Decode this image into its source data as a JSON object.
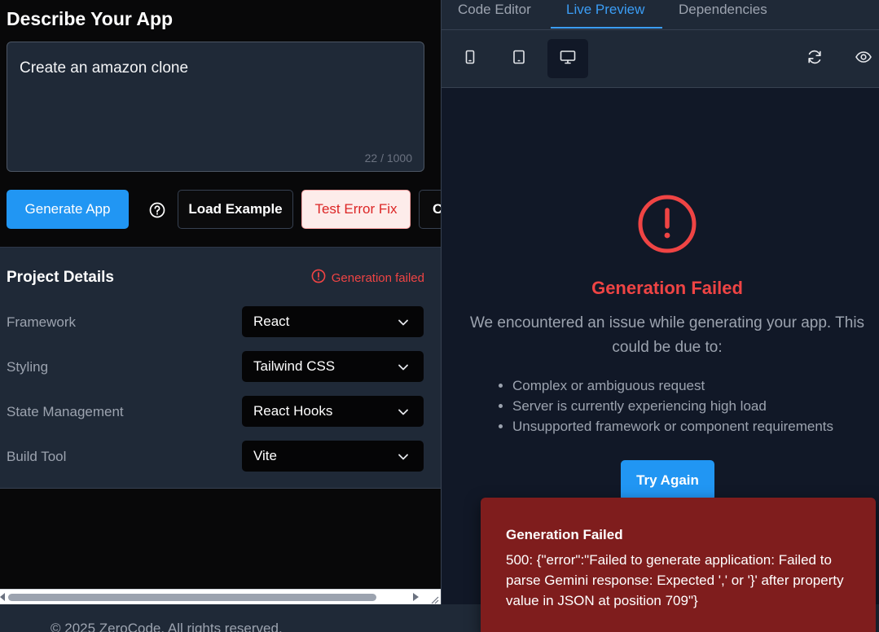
{
  "left": {
    "title": "Describe Your App",
    "prompt": {
      "value": "Create an amazon clone",
      "char_count": "22 / 1000"
    },
    "buttons": {
      "generate": "Generate App",
      "help_icon": "question-circle-icon",
      "load_example": "Load Example",
      "test_error_fix": "Test Error Fix",
      "cut_off": "C"
    },
    "project_details": {
      "title": "Project Details",
      "status_icon": "alert-circle-icon",
      "status": "Generation failed",
      "fields": [
        {
          "label": "Framework",
          "value": "React"
        },
        {
          "label": "Styling",
          "value": "Tailwind CSS"
        },
        {
          "label": "State Management",
          "value": "React Hooks"
        },
        {
          "label": "Build Tool",
          "value": "Vite"
        }
      ]
    }
  },
  "right": {
    "tabs": [
      "Code Editor",
      "Live Preview",
      "Dependencies"
    ],
    "active_tab": "Live Preview",
    "toolbar": {
      "devices": [
        "mobile-icon",
        "tablet-icon",
        "desktop-icon"
      ],
      "active_device": "desktop-icon",
      "actions": [
        "refresh-icon",
        "eye-icon"
      ]
    },
    "error": {
      "icon": "alert-circle-icon",
      "title": "Generation Failed",
      "description": "We encountered an issue while generating your app. This could be due to:",
      "reasons": [
        "Complex or ambiguous request",
        "Server is currently experiencing high load",
        "Unsupported framework or component requirements"
      ],
      "retry_label": "Try Again"
    }
  },
  "toast": {
    "title": "Generation Failed",
    "message": "500: {\"error\":\"Failed to generate application: Failed to parse Gemini response: Expected ',' or '}' after property value in JSON at position 709\"}"
  },
  "footer": {
    "text": "© 2025 ZeroCode. All rights reserved."
  },
  "colors": {
    "accent": "#2196f3",
    "error": "#ef4444",
    "toast_bg": "#7f1d1d",
    "panel_bg": "#1f2937"
  }
}
